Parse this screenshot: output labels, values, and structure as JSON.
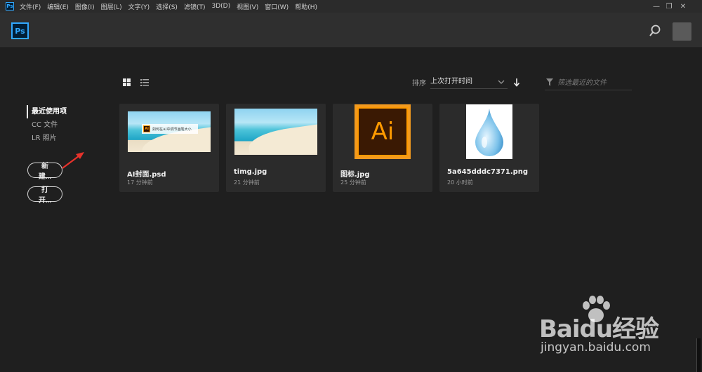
{
  "menubar": {
    "app_icon": "Ps",
    "items": [
      "文件(F)",
      "编辑(E)",
      "图像(I)",
      "图层(L)",
      "文字(Y)",
      "选择(S)",
      "滤镜(T)",
      "3D(D)",
      "视图(V)",
      "窗口(W)",
      "帮助(H)"
    ],
    "window_controls": [
      "—",
      "❐",
      "✕"
    ]
  },
  "header": {
    "logo": "Ps"
  },
  "sidebar": {
    "items": [
      {
        "label": "最近使用项",
        "active": true
      },
      {
        "label": "CC 文件",
        "active": false
      },
      {
        "label": "LR 照片",
        "active": false
      }
    ],
    "new_button": "新建...",
    "open_button": "打开..."
  },
  "toolbar": {
    "sort_label": "排序",
    "sort_value": "上次打开时间",
    "filter_placeholder": "筛选最近的文件"
  },
  "files": [
    {
      "name": "AI封面.psd",
      "time": "17 分钟前",
      "banner_text": "如何在AI中调节画笔大小"
    },
    {
      "name": "timg.jpg",
      "time": "21 分钟前"
    },
    {
      "name": "图标.jpg",
      "time": "25 分钟前",
      "icon_text": "Ai"
    },
    {
      "name": "5a645dddc7371.png",
      "time": "20 小时前"
    }
  ],
  "watermark": {
    "brand": "Baidu经验",
    "url": "jingyan.baidu.com"
  },
  "colors": {
    "ps_blue": "#31a8ff",
    "ai_orange": "#ff9a00",
    "annotation_red": "#e8322b",
    "background": "#1f1f1f"
  }
}
